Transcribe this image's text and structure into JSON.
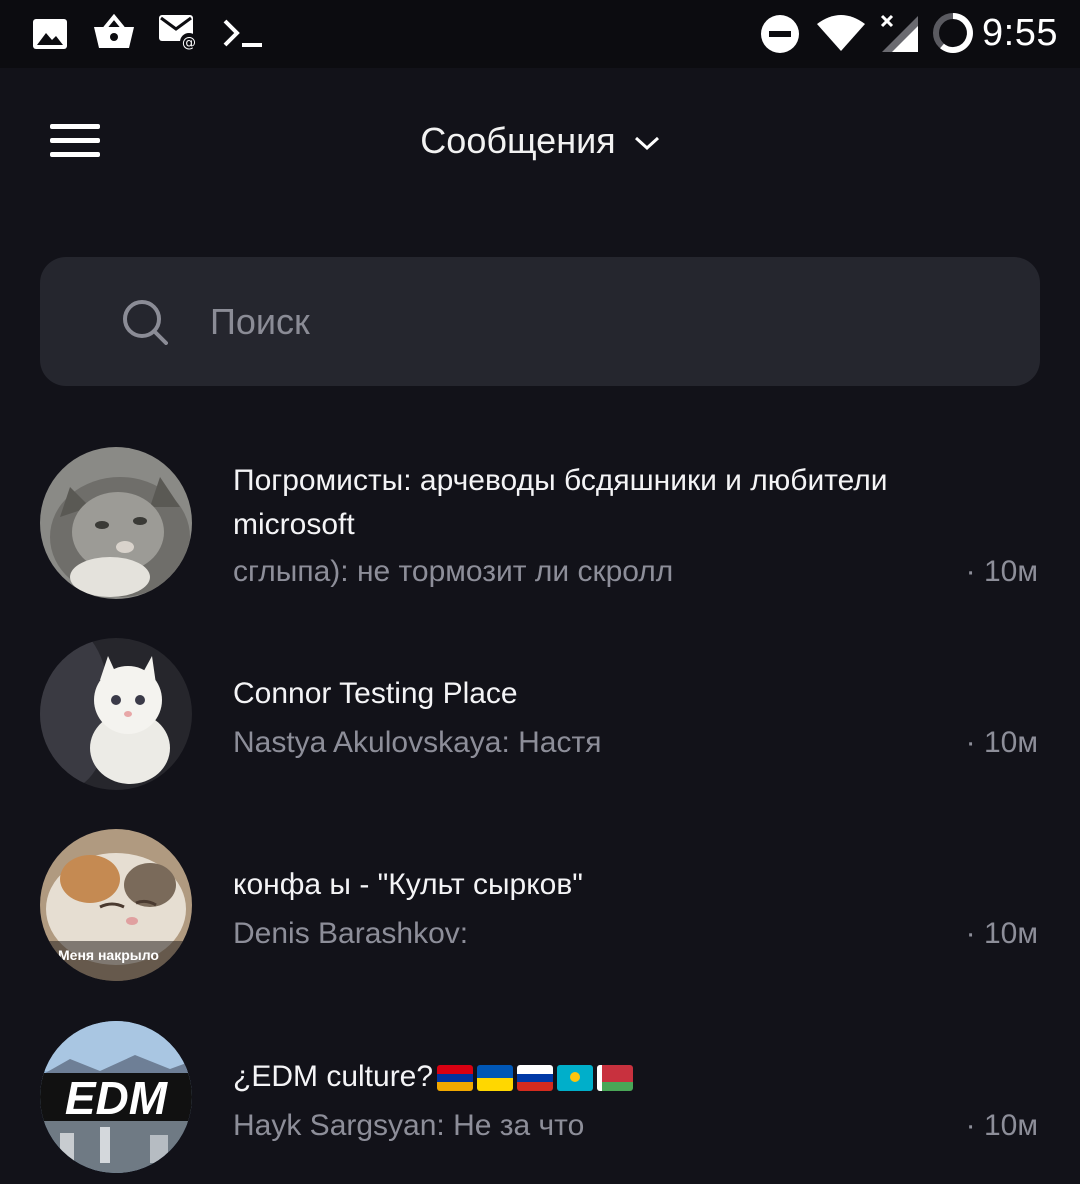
{
  "status_bar": {
    "time": "9:55",
    "left_icons": [
      "image-icon",
      "basket-icon",
      "email-icon",
      "terminal-icon"
    ],
    "right_icons": [
      "do-not-disturb-icon",
      "wifi-icon",
      "signal-icon",
      "battery-icon"
    ]
  },
  "header": {
    "title": "Сообщения"
  },
  "search": {
    "placeholder": "Поиск"
  },
  "chats": [
    {
      "title": "Погромисты: арчеводы бсдяшники и любители microsoft",
      "last_message": "сглыпа): не тормозит ли скролл",
      "time": "· 10м"
    },
    {
      "title": "Connor Testing Place",
      "last_message": "Nastya Akulovskaya: Настя",
      "time": "· 10м"
    },
    {
      "title": "конфа ы - \"Культ сырков\"",
      "last_message": "Denis Barashkov:",
      "time": "· 10м",
      "avatar_caption": "Меня накрыло"
    },
    {
      "title": "¿EDM culture?",
      "title_flags": [
        "armenia-flag-icon",
        "ukraine-flag-icon",
        "russia-flag-icon",
        "kazakhstan-flag-icon",
        "belarus-flag-icon"
      ],
      "last_message": "Hayk Sargsyan: Не за что",
      "time": "· 10м",
      "avatar_label": "EDM"
    }
  ],
  "colors": {
    "background": "#121219",
    "search_bg": "#25262e",
    "secondary_text": "#8d8e99"
  }
}
